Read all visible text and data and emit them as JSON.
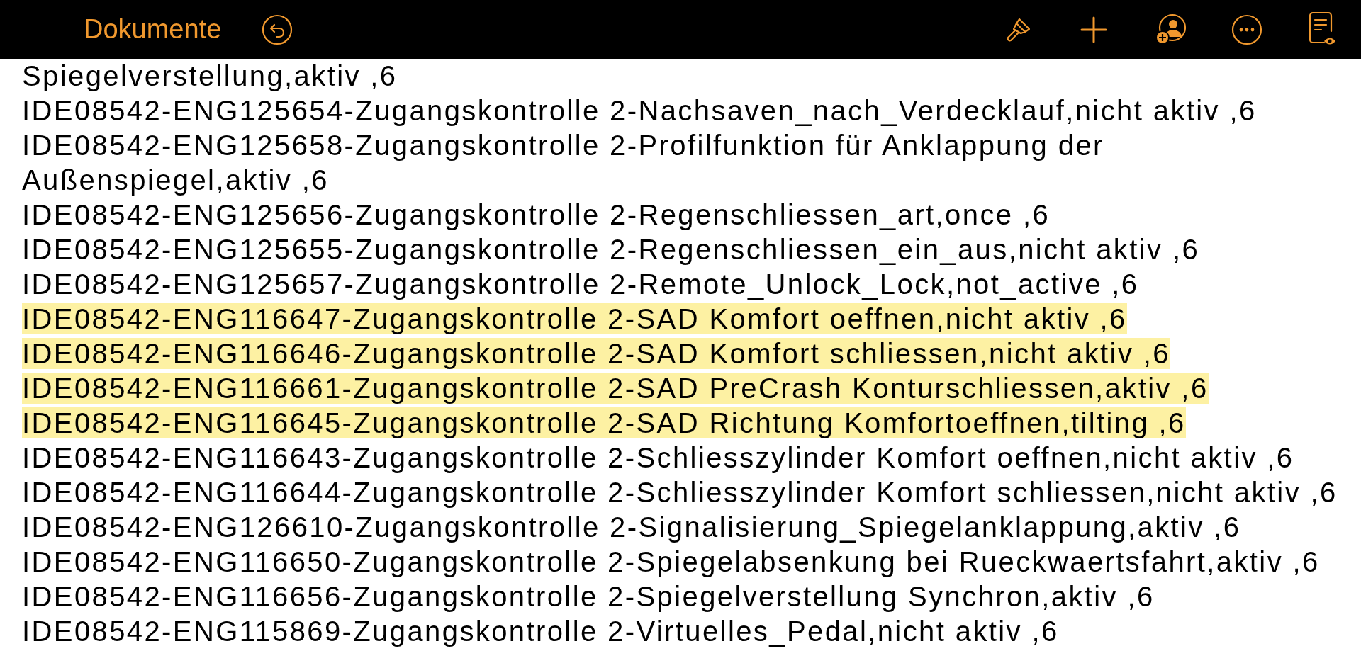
{
  "toolbar": {
    "back_label": "Dokumente"
  },
  "lines": [
    {
      "text": "Spiegelverstellung,aktiv ,6",
      "highlighted": false
    },
    {
      "text": "IDE08542-ENG125654-Zugangskontrolle 2-Nachsaven_nach_Verdecklauf,nicht aktiv ,6",
      "highlighted": false
    },
    {
      "text": "IDE08542-ENG125658-Zugangskontrolle 2-Profilfunktion für Anklappung der Außenspiegel,aktiv ,6",
      "highlighted": false
    },
    {
      "text": "IDE08542-ENG125656-Zugangskontrolle 2-Regenschliessen_art,once ,6",
      "highlighted": false
    },
    {
      "text": "IDE08542-ENG125655-Zugangskontrolle 2-Regenschliessen_ein_aus,nicht aktiv ,6",
      "highlighted": false
    },
    {
      "text": "IDE08542-ENG125657-Zugangskontrolle 2-Remote_Unlock_Lock,not_active ,6",
      "highlighted": false
    },
    {
      "text": "IDE08542-ENG116647-Zugangskontrolle 2-SAD Komfort oeffnen,nicht aktiv ,6",
      "highlighted": true
    },
    {
      "text": "IDE08542-ENG116646-Zugangskontrolle 2-SAD Komfort schliessen,nicht aktiv ,6",
      "highlighted": true
    },
    {
      "text": "IDE08542-ENG116661-Zugangskontrolle 2-SAD PreCrash Konturschliessen,aktiv ,6",
      "highlighted": true
    },
    {
      "text": "IDE08542-ENG116645-Zugangskontrolle 2-SAD Richtung Komfortoeffnen,tilting ,6",
      "highlighted": true
    },
    {
      "text": "IDE08542-ENG116643-Zugangskontrolle 2-Schliesszylinder Komfort oeffnen,nicht aktiv ,6",
      "highlighted": false
    },
    {
      "text": "IDE08542-ENG116644-Zugangskontrolle 2-Schliesszylinder Komfort schliessen,nicht aktiv ,6",
      "highlighted": false
    },
    {
      "text": "IDE08542-ENG126610-Zugangskontrolle 2-Signalisierung_Spiegelanklappung,aktiv ,6",
      "highlighted": false
    },
    {
      "text": "IDE08542-ENG116650-Zugangskontrolle 2-Spiegelabsenkung bei Rueckwaertsfahrt,aktiv ,6",
      "highlighted": false
    },
    {
      "text": "IDE08542-ENG116656-Zugangskontrolle 2-Spiegelverstellung Synchron,aktiv ,6",
      "highlighted": false
    },
    {
      "text": "IDE08542-ENG115869-Zugangskontrolle 2-Virtuelles_Pedal,nicht aktiv ,6",
      "highlighted": false
    }
  ]
}
